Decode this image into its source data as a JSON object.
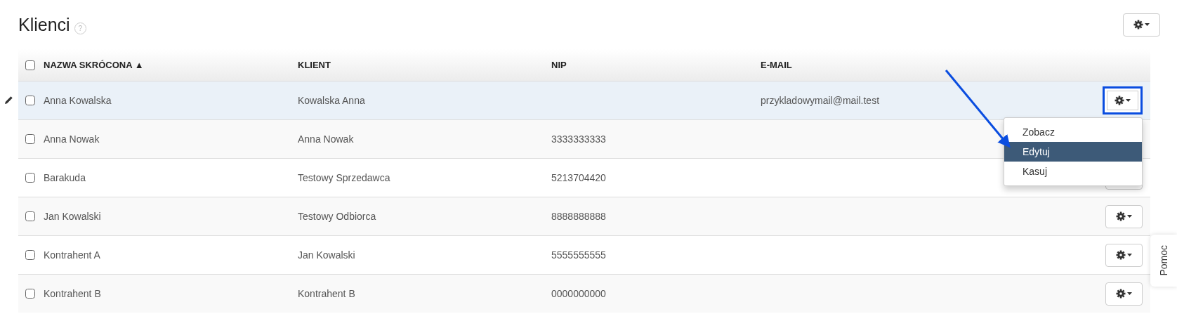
{
  "page": {
    "title": "Klienci",
    "help_icon": "?"
  },
  "table": {
    "columns": [
      {
        "label": "NAZWA SKRÓCONA",
        "sort_mark": "▲",
        "checked": false
      },
      {
        "label": "KLIENT"
      },
      {
        "label": "NIP"
      },
      {
        "label": "E-MAIL"
      }
    ],
    "rows": [
      {
        "checked": false,
        "highlighted": true,
        "cells": [
          "Anna Kowalska",
          "Kowalska Anna",
          "",
          "przykladowymail@mail.test"
        ],
        "button_focused": true,
        "menu": [
          {
            "label": "Zobacz",
            "selected": false
          },
          {
            "label": "Edytuj",
            "selected": true
          },
          {
            "label": "Kasuj",
            "selected": false
          }
        ]
      },
      {
        "checked": false,
        "highlighted": false,
        "cells": [
          "Anna Nowak",
          "Anna Nowak",
          "3333333333",
          ""
        ]
      },
      {
        "checked": false,
        "highlighted": false,
        "cells": [
          "Barakuda",
          "Testowy Sprzedawca",
          "5213704420",
          ""
        ]
      },
      {
        "checked": false,
        "highlighted": false,
        "cells": [
          "Jan Kowalski",
          "Testowy Odbiorca",
          "8888888888",
          ""
        ]
      },
      {
        "checked": false,
        "highlighted": false,
        "cells": [
          "Kontrahent A",
          "Jan Kowalski",
          "5555555555",
          ""
        ]
      },
      {
        "checked": false,
        "highlighted": false,
        "cells": [
          "Kontrahent B",
          "Kontrahent B",
          "0000000000",
          ""
        ]
      }
    ]
  },
  "help_tab": {
    "label": "Pomoc"
  }
}
